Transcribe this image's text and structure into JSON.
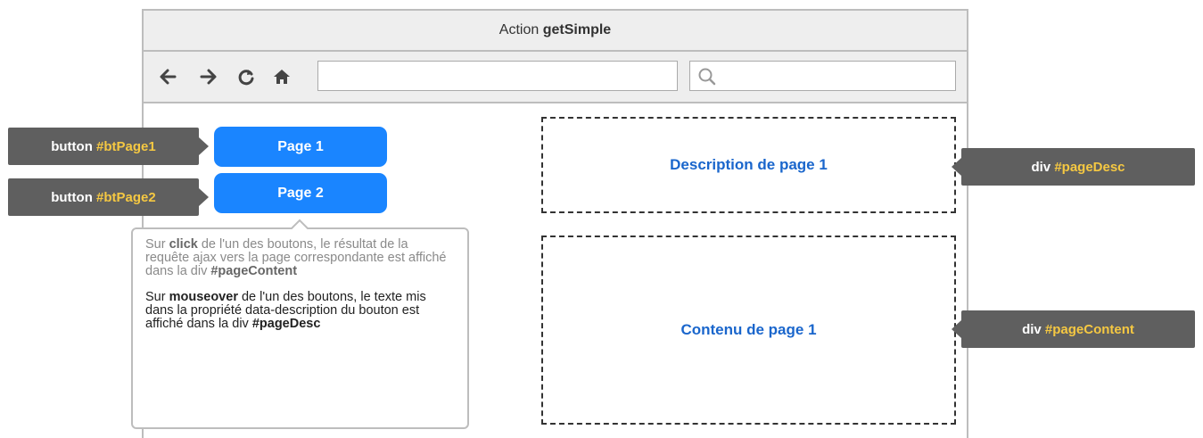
{
  "window": {
    "title_prefix": "Action ",
    "title_bold": "getSimple"
  },
  "toolbar": {
    "icons": [
      "back-arrow-icon",
      "forward-arrow-icon",
      "reload-icon",
      "home-icon",
      "search-icon"
    ]
  },
  "buttons": {
    "page1_label": "Page 1",
    "page2_label": "Page 2"
  },
  "areas": {
    "description_text": "Description de page 1",
    "content_text": "Contenu de page 1"
  },
  "callouts": {
    "bt1_prefix": "button ",
    "bt1_id": "#btPage1",
    "bt2_prefix": "button ",
    "bt2_id": "#btPage2",
    "desc_prefix": "div ",
    "desc_id": "#pageDesc",
    "content_prefix": "div ",
    "content_id": "#pageContent"
  },
  "tooltip": {
    "p1_a": "Sur ",
    "p1_b": "click",
    "p1_c": " de l'un des boutons, le résultat de la requête ajax vers la page correspondante est affiché dans la div ",
    "p1_d": "#pageContent",
    "p2_a": "Sur ",
    "p2_b": "mouseover",
    "p2_c": " de l'un des boutons, le texte mis dans la propriété data-description du bouton est affiché dans la div ",
    "p2_d": "#pageDesc"
  },
  "colors": {
    "button_blue": "#1a85ff",
    "label_gray": "#5f5f5f",
    "highlight_yellow": "#f5c842",
    "area_text_blue": "#1a66cc"
  }
}
